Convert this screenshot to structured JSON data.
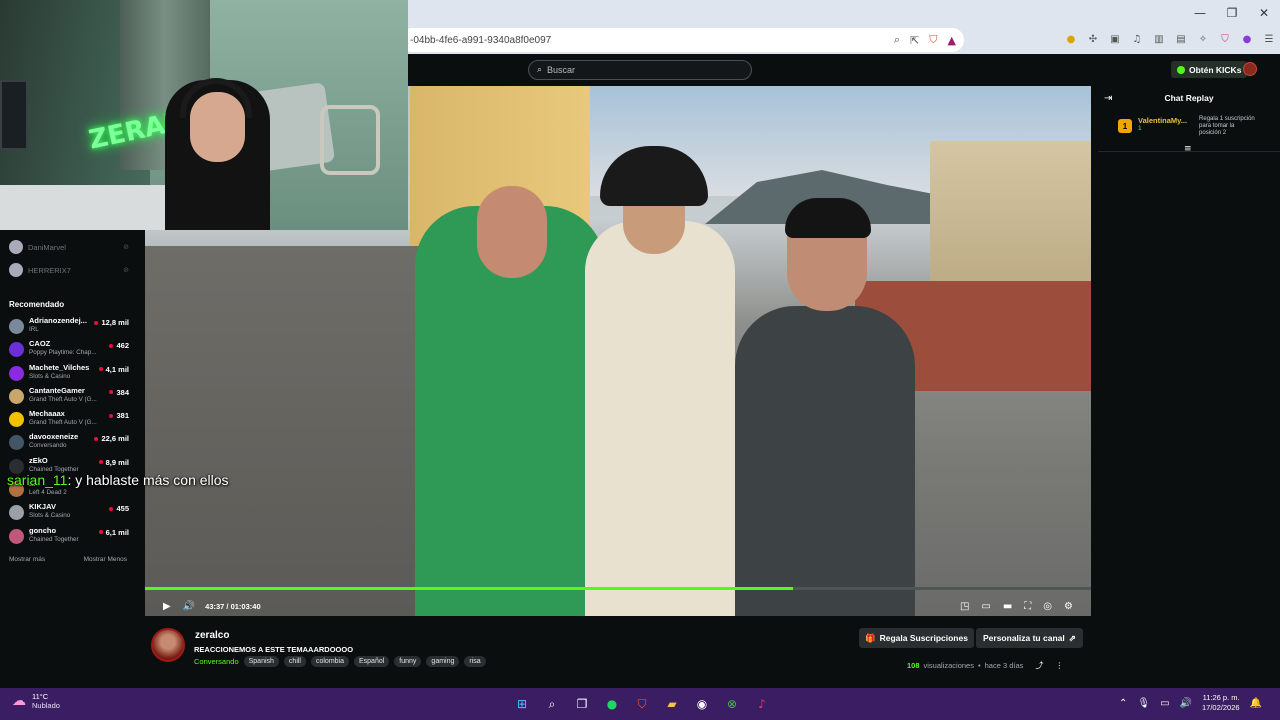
{
  "browser": {
    "url": "-04bb-4fe6-a991-9340a8f0e097",
    "window_controls": [
      "—",
      "❐",
      "✕"
    ]
  },
  "header": {
    "search_placeholder": "Buscar",
    "kicks_button": "Obtén KICKs"
  },
  "webcam": {
    "neon_text": "ZERALCO"
  },
  "sidebar": {
    "following": [
      {
        "name": "DaniMarvel"
      },
      {
        "name": "HERRERIX7"
      }
    ],
    "recommended_title": "Recomendado",
    "recommended": [
      {
        "name": "Adrianozendej...",
        "category": "IRL",
        "viewers": "12,8 mil",
        "color": "#7a8a9a"
      },
      {
        "name": "CAOZ",
        "category": "Poppy Playtime: Chap...",
        "viewers": "462",
        "color": "#6a2fd8"
      },
      {
        "name": "Machete_Vilches",
        "category": "Slots & Casino",
        "viewers": "4,1 mil",
        "color": "#8a2be2"
      },
      {
        "name": "CantanteGamer",
        "category": "Grand Theft Auto V (G...",
        "viewers": "384",
        "color": "#c9a66b"
      },
      {
        "name": "Mechaaax",
        "category": "Grand Theft Auto V (G...",
        "viewers": "381",
        "color": "#f2c200"
      },
      {
        "name": "davooxeneize",
        "category": "Conversando",
        "viewers": "22,6 mil",
        "color": "#445566"
      },
      {
        "name": "zEkO",
        "category": "Chained Together",
        "viewers": "8,9 mil",
        "color": "#2a2e31"
      },
      {
        "name": "...",
        "category": "Left 4 Dead 2",
        "viewers": "",
        "color": "#b07040"
      },
      {
        "name": "KIKJAV",
        "category": "Slots & Casino",
        "viewers": "455",
        "color": "#9aa0a6"
      },
      {
        "name": "goncho",
        "category": "Chained Together",
        "viewers": "6,1 mil",
        "color": "#c0587a"
      }
    ],
    "show_more": "Mostrar más",
    "show_less": "Mostrar Menos"
  },
  "overlay_chat": {
    "user": "sarian_11",
    "message": ": y hablaste más con ellos"
  },
  "player": {
    "time": "43:37 / 01:03:40",
    "progress_fraction": 0.685
  },
  "chat": {
    "title": "Chat Replay",
    "gift": {
      "badge": "1",
      "user": "ValentinaMy...",
      "count": "1",
      "message": "Regala 1 suscripción para tomar la posición 2"
    }
  },
  "channel": {
    "name": "zeralco",
    "title": "REACCIONEMOS A ESTE TEMAAARDOOOO",
    "category": "Conversando",
    "tags": [
      "Spanish",
      "chill",
      "colombia",
      "Español",
      "funny",
      "gaming",
      "risa"
    ],
    "gift_subs_button": "Regala Suscripciones",
    "customize_button": "Personaliza tu canal",
    "views": "108",
    "views_label": "visualizaciones",
    "separator": "•",
    "ago": "hace 3 días"
  },
  "taskbar": {
    "temperature": "11°C",
    "weather": "Nublado",
    "time": "11:26 p. m.",
    "date": "17/02/2026"
  }
}
